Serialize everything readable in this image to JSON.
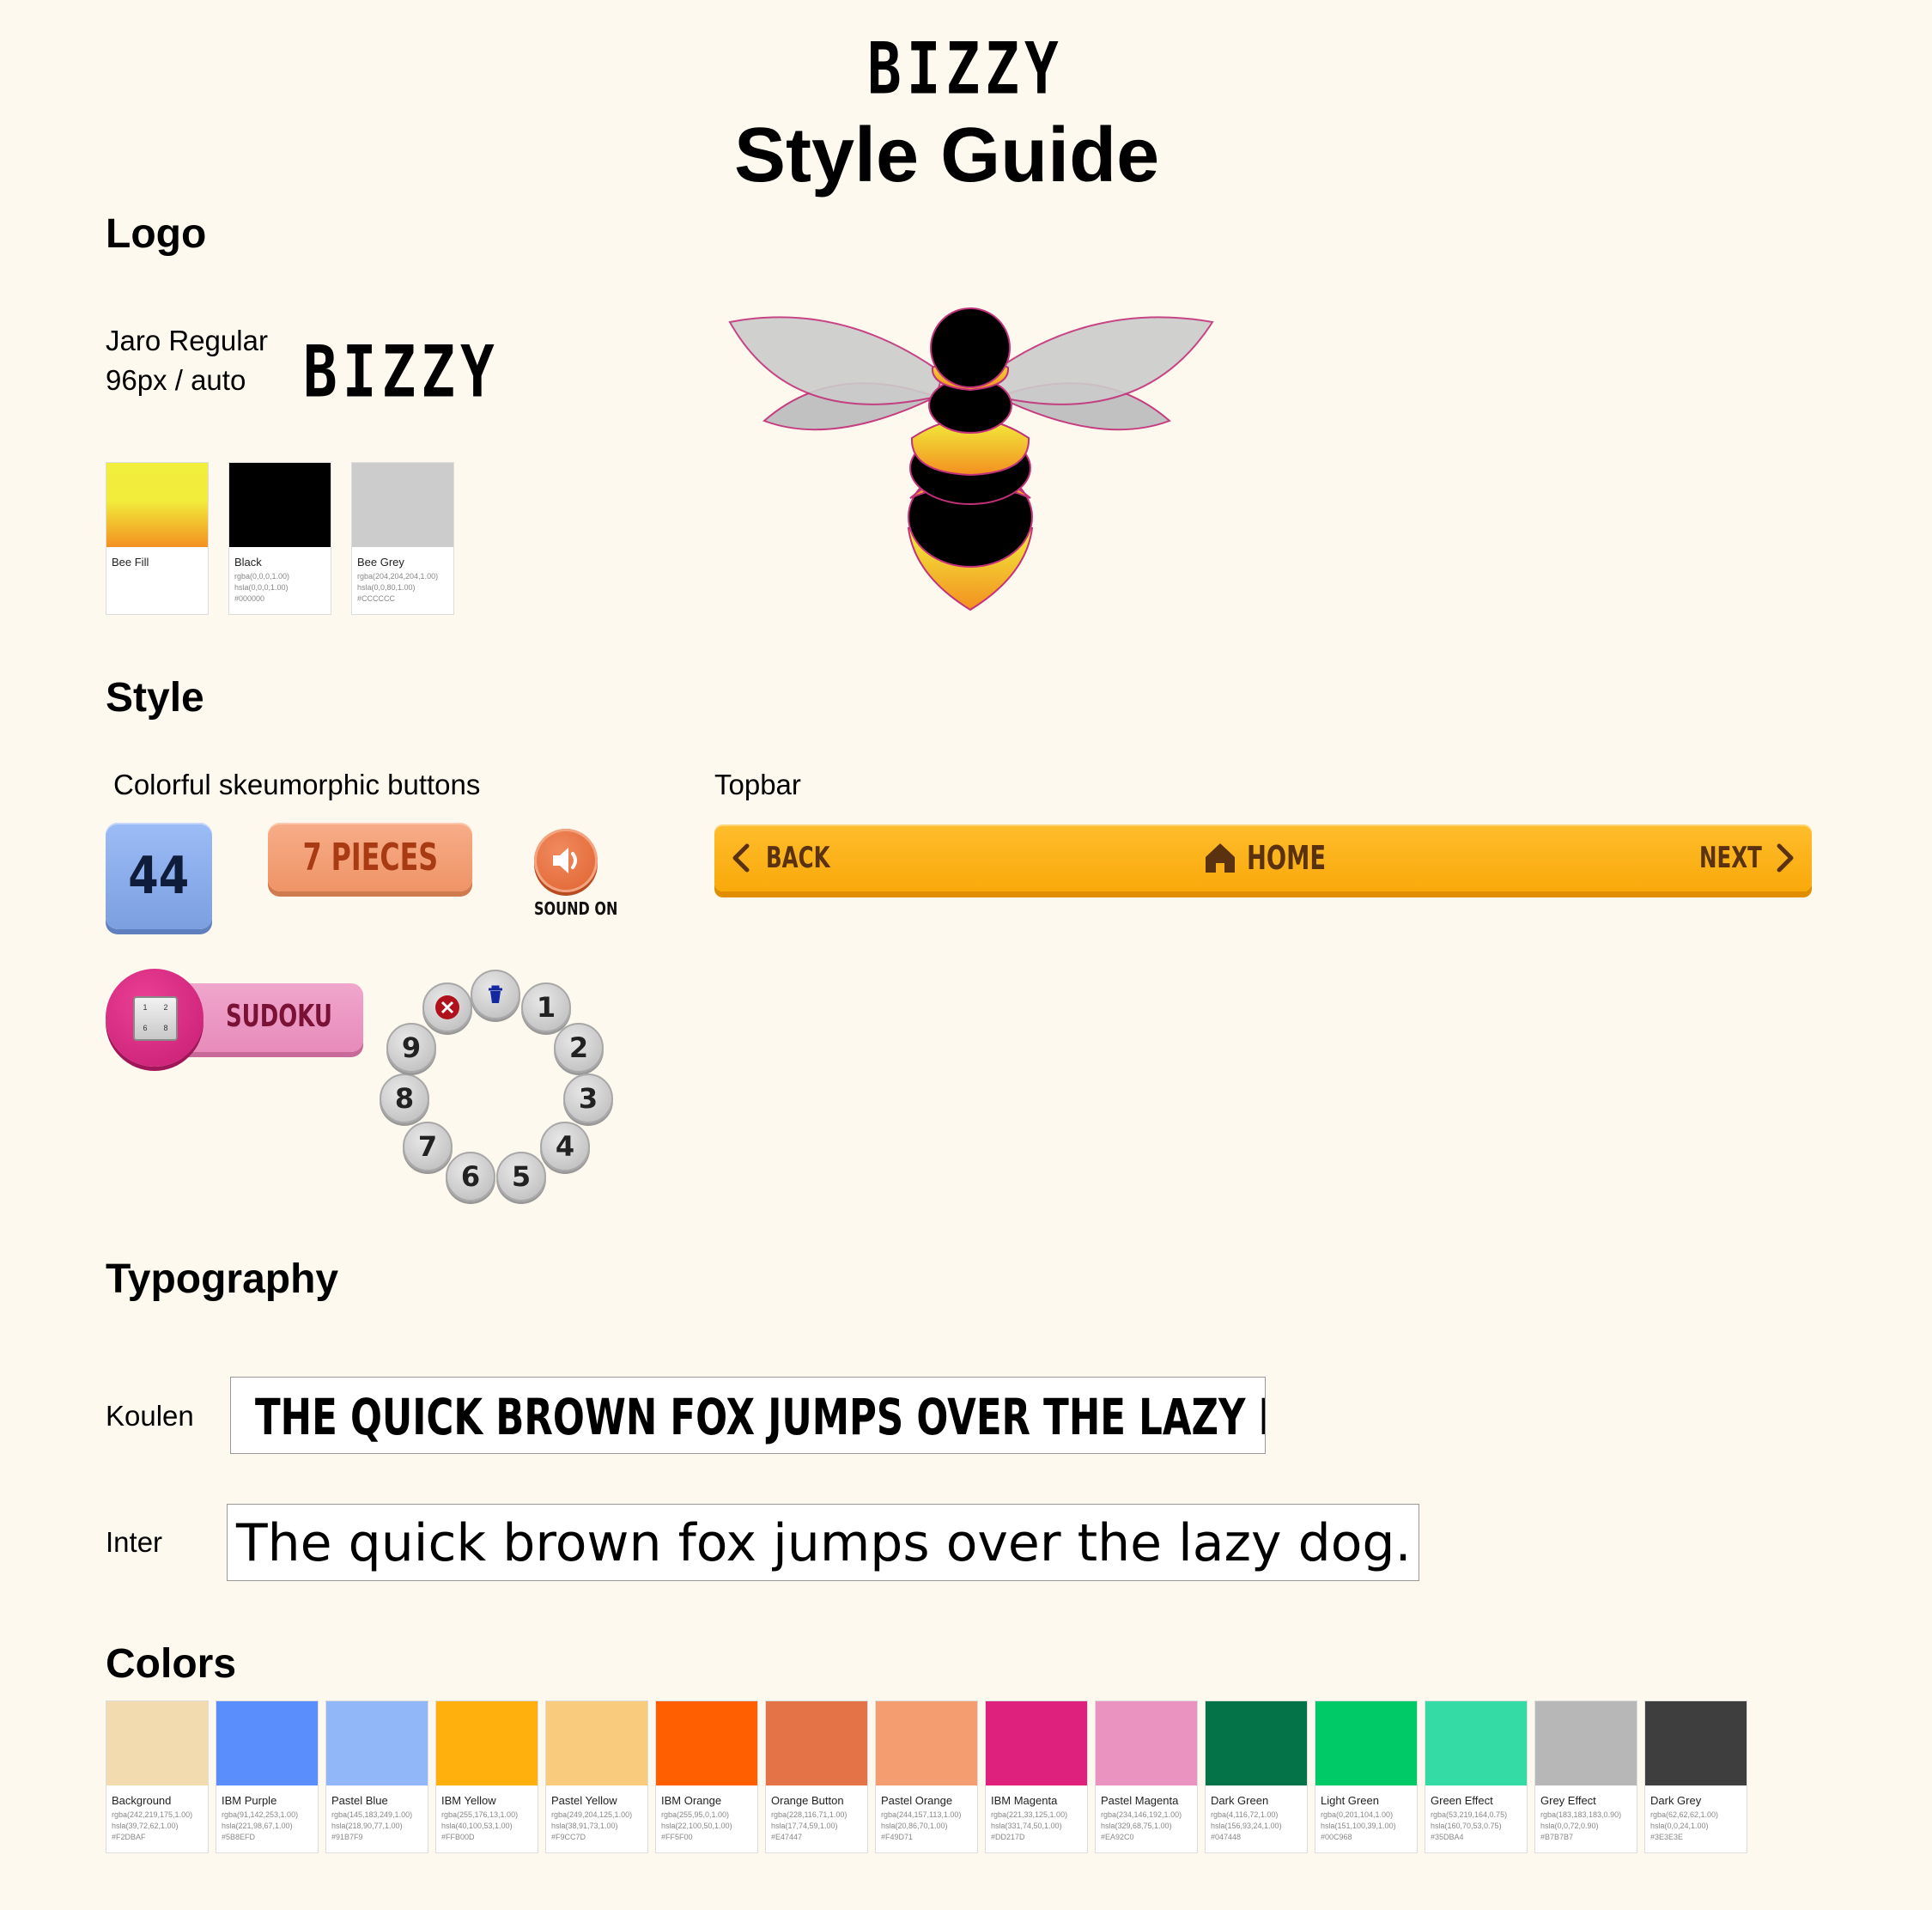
{
  "header": {
    "brand": "BIZZY",
    "title": "Style Guide"
  },
  "logo_section": {
    "heading": "Logo",
    "font_name": "Jaro Regular",
    "font_size": "96px / auto",
    "wordmark": "BIZZY",
    "swatches": [
      {
        "name": "Bee Fill",
        "gradient": [
          "#F2EE3C",
          "#F2EC3B",
          "#F39020"
        ],
        "values": [
          "",
          "",
          ""
        ]
      },
      {
        "name": "Black",
        "color": "#000000",
        "values": [
          "rgba(0,0,0,1.00)",
          "hsla(0,0,0,1.00)",
          "#000000"
        ]
      },
      {
        "name": "Bee Grey",
        "color": "#CCCCCC",
        "values": [
          "rgba(204,204,204,1.00)",
          "hsla(0,0,80,1.00)",
          "#CCCCCC"
        ]
      }
    ]
  },
  "style_section": {
    "heading": "Style",
    "buttons_label": "Colorful skeumorphic buttons",
    "topbar_label": "Topbar",
    "number_button": "44",
    "pieces_button": "7 PIECES",
    "sound_label": "SOUND ON",
    "sudoku_label": "SUDOKU",
    "sudoku_icon_digits": [
      "1",
      "2",
      "6",
      "8"
    ],
    "topbar": {
      "back": "BACK",
      "home": "HOME",
      "next": "NEXT"
    },
    "number_ring": [
      "1",
      "2",
      "3",
      "4",
      "5",
      "6",
      "7",
      "8",
      "9"
    ]
  },
  "typography_section": {
    "heading": "Typography",
    "fonts": [
      {
        "name": "Koulen",
        "sample": "THE QUICK BROWN FOX JUMPS OVER THE LAZY DOG."
      },
      {
        "name": "Inter",
        "sample": "The quick brown fox jumps over the lazy dog."
      }
    ]
  },
  "colors_section": {
    "heading": "Colors",
    "palette": [
      {
        "name": "Background",
        "hex": "#F2DBAF",
        "rgba": "rgba(242,219,175,1.00)",
        "hsla": "hsla(39,72,62,1.00)"
      },
      {
        "name": "IBM Purple",
        "hex": "#5B8EFD",
        "rgba": "rgba(91,142,253,1.00)",
        "hsla": "hsla(221,98,67,1.00)"
      },
      {
        "name": "Pastel Blue",
        "hex": "#91B7F9",
        "rgba": "rgba(145,183,249,1.00)",
        "hsla": "hsla(218,90,77,1.00)"
      },
      {
        "name": "IBM Yellow",
        "hex": "#FFB00D",
        "rgba": "rgba(255,176,13,1.00)",
        "hsla": "hsla(40,100,53,1.00)"
      },
      {
        "name": "Pastel Yellow",
        "hex": "#F9CC7D",
        "rgba": "rgba(249,204,125,1.00)",
        "hsla": "hsla(38,91,73,1.00)"
      },
      {
        "name": "IBM Orange",
        "hex": "#FF5F00",
        "rgba": "rgba(255,95,0,1.00)",
        "hsla": "hsla(22,100,50,1.00)"
      },
      {
        "name": "Orange Button",
        "hex": "#E47447",
        "rgba": "rgba(228,116,71,1.00)",
        "hsla": "hsla(17,74,59,1.00)"
      },
      {
        "name": "Pastel Orange",
        "hex": "#F49D71",
        "rgba": "rgba(244,157,113,1.00)",
        "hsla": "hsla(20,86,70,1.00)"
      },
      {
        "name": "IBM Magenta",
        "hex": "#DD217D",
        "rgba": "rgba(221,33,125,1.00)",
        "hsla": "hsla(331,74,50,1.00)"
      },
      {
        "name": "Pastel Magenta",
        "hex": "#EA92C0",
        "rgba": "rgba(234,146,192,1.00)",
        "hsla": "hsla(329,68,75,1.00)"
      },
      {
        "name": "Dark Green",
        "hex": "#047448",
        "rgba": "rgba(4,116,72,1.00)",
        "hsla": "hsla(156,93,24,1.00)"
      },
      {
        "name": "Light Green",
        "hex": "#00C968",
        "rgba": "rgba(0,201,104,1.00)",
        "hsla": "hsla(151,100,39,1.00)"
      },
      {
        "name": "Green Effect",
        "hex": "#35DBA4",
        "rgba": "rgba(53,219,164,0.75)",
        "hsla": "hsla(160,70,53,0.75)"
      },
      {
        "name": "Grey Effect",
        "hex": "#B7B7B7",
        "rgba": "rgba(183,183,183,0.90)",
        "hsla": "hsla(0,0,72,0.90)"
      },
      {
        "name": "Dark Grey",
        "hex": "#3E3E3E",
        "rgba": "rgba(62,62,62,1.00)",
        "hsla": "hsla(0,0,24,1.00)"
      }
    ]
  }
}
